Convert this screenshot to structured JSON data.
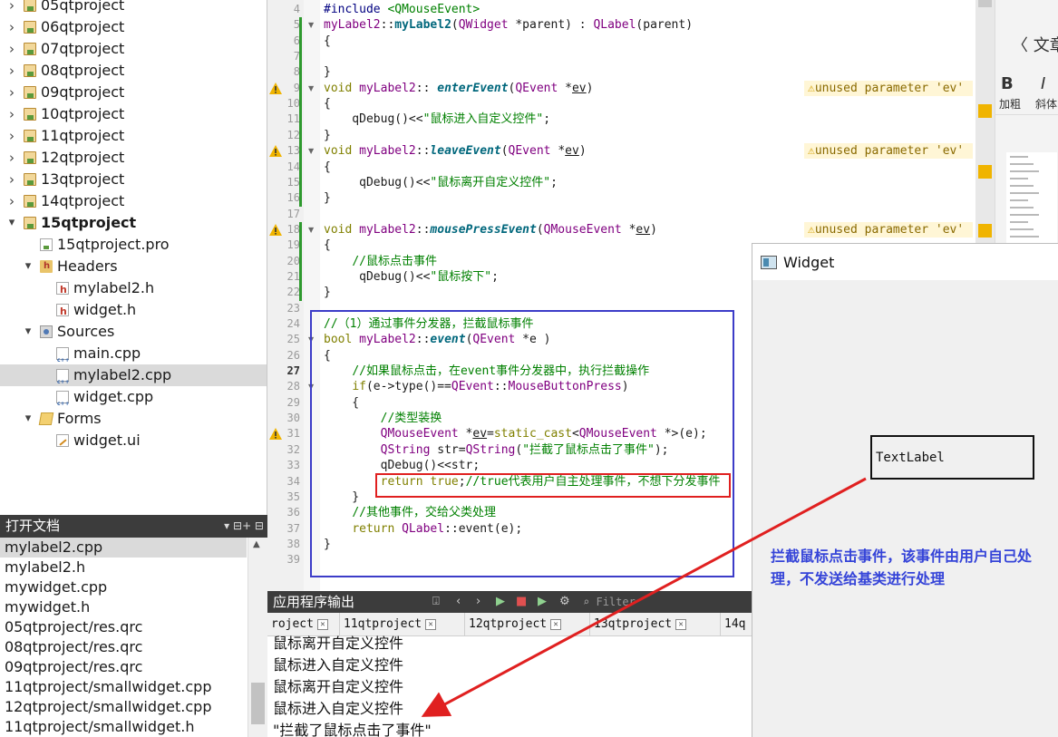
{
  "project_tree": [
    {
      "label": "05qtproject",
      "type": "project",
      "indent": 0,
      "arrow": "›"
    },
    {
      "label": "06qtproject",
      "type": "project",
      "indent": 0,
      "arrow": "›"
    },
    {
      "label": "07qtproject",
      "type": "project",
      "indent": 0,
      "arrow": "›"
    },
    {
      "label": "08qtproject",
      "type": "project",
      "indent": 0,
      "arrow": "›"
    },
    {
      "label": "09qtproject",
      "type": "project",
      "indent": 0,
      "arrow": "›"
    },
    {
      "label": "10qtproject",
      "type": "project",
      "indent": 0,
      "arrow": "›"
    },
    {
      "label": "11qtproject",
      "type": "project",
      "indent": 0,
      "arrow": "›"
    },
    {
      "label": "12qtproject",
      "type": "project",
      "indent": 0,
      "arrow": "›"
    },
    {
      "label": "13qtproject",
      "type": "project",
      "indent": 0,
      "arrow": "›"
    },
    {
      "label": "14qtproject",
      "type": "project",
      "indent": 0,
      "arrow": "›"
    },
    {
      "label": "15qtproject",
      "type": "project",
      "indent": 0,
      "arrow": "⌄",
      "bold": true
    },
    {
      "label": "15qtproject.pro",
      "type": "pro",
      "indent": 1,
      "arrow": ""
    },
    {
      "label": "Headers",
      "type": "folder-h",
      "indent": 1,
      "arrow": "⌄"
    },
    {
      "label": "mylabel2.h",
      "type": "h",
      "indent": 2,
      "arrow": ""
    },
    {
      "label": "widget.h",
      "type": "h",
      "indent": 2,
      "arrow": ""
    },
    {
      "label": "Sources",
      "type": "folder-s",
      "indent": 1,
      "arrow": "⌄"
    },
    {
      "label": "main.cpp",
      "type": "cpp",
      "indent": 2,
      "arrow": ""
    },
    {
      "label": "mylabel2.cpp",
      "type": "cpp",
      "indent": 2,
      "arrow": "",
      "selected": true
    },
    {
      "label": "widget.cpp",
      "type": "cpp",
      "indent": 2,
      "arrow": ""
    },
    {
      "label": "Forms",
      "type": "folder-f",
      "indent": 1,
      "arrow": "⌄"
    },
    {
      "label": "widget.ui",
      "type": "ui",
      "indent": 2,
      "arrow": ""
    }
  ],
  "open_docs": {
    "title": "打开文档",
    "tools": "▾ ⊟+ ⊟",
    "items": [
      {
        "label": "mylabel2.cpp",
        "selected": true
      },
      {
        "label": "mylabel2.h"
      },
      {
        "label": "mywidget.cpp"
      },
      {
        "label": "mywidget.h"
      },
      {
        "label": "05qtproject/res.qrc"
      },
      {
        "label": "08qtproject/res.qrc"
      },
      {
        "label": "09qtproject/res.qrc"
      },
      {
        "label": "11qtproject/smallwidget.cpp"
      },
      {
        "label": "12qtproject/smallwidget.cpp"
      },
      {
        "label": "11qtproject/smallwidget.h"
      }
    ]
  },
  "editor": {
    "current_line": 27,
    "warning_text": "unused parameter 'ev'",
    "lines": [
      {
        "n": 4,
        "html": "<span class='pp'>#include</span> <span class='incl'>&lt;QMouseEvent&gt;</span>"
      },
      {
        "n": 5,
        "html": "<span class='ty'>myLabel2</span>::<span class='fn-b'>myLabel2</span>(<span class='cls'>QWidget</span> *parent) : <span class='cls'>QLabel</span>(parent)"
      },
      {
        "n": 6,
        "html": "{"
      },
      {
        "n": 7,
        "html": ""
      },
      {
        "n": 8,
        "html": "}"
      },
      {
        "n": 9,
        "html": "<span class='kw'>void</span> <span class='ty'>myLabel2</span>:: <span class='fn-i'>enterEvent</span>(<span class='cls'>QEvent</span> *<span class='ul'>ev</span>)",
        "warn": true
      },
      {
        "n": 10,
        "html": "{"
      },
      {
        "n": 11,
        "html": "    qDebug()&lt;&lt;<span class='st'>\"鼠标进入自定义控件\"</span>;"
      },
      {
        "n": 12,
        "html": "}"
      },
      {
        "n": 13,
        "html": "<span class='kw'>void</span> <span class='ty'>myLabel2</span>::<span class='fn-i'>leaveEvent</span>(<span class='cls'>QEvent</span> *<span class='ul'>ev</span>)",
        "warn": true
      },
      {
        "n": 14,
        "html": "{"
      },
      {
        "n": 15,
        "html": "     qDebug()&lt;&lt;<span class='st'>\"鼠标离开自定义控件\"</span>;"
      },
      {
        "n": 16,
        "html": "}"
      },
      {
        "n": 17,
        "html": ""
      },
      {
        "n": 18,
        "html": "<span class='kw'>void</span> <span class='ty'>myLabel2</span>::<span class='fn-i'>mousePressEvent</span>(<span class='cls'>QMouseEvent</span> *<span class='ul'>ev</span>)",
        "warn": true
      },
      {
        "n": 19,
        "html": "{"
      },
      {
        "n": 20,
        "html": "    <span class='cm'>//鼠标点击事件</span>"
      },
      {
        "n": 21,
        "html": "     qDebug()&lt;&lt;<span class='st'>\"鼠标按下\"</span>;"
      },
      {
        "n": 22,
        "html": "}"
      },
      {
        "n": 23,
        "html": ""
      },
      {
        "n": 24,
        "html": "<span class='cm'>//（1）通过事件分发器，拦截鼠标事件</span>"
      },
      {
        "n": 25,
        "html": "<span class='kw'>bool</span> <span class='ty'>myLabel2</span>::<span class='fn-i'>event</span>(<span class='cls'>QEvent</span> *e )"
      },
      {
        "n": 26,
        "html": "{"
      },
      {
        "n": 27,
        "html": "    <span class='cm'>//如果鼠标点击，在event事件分发器中，执行拦截操作</span>"
      },
      {
        "n": 28,
        "html": "    <span class='kw'>if</span>(e-&gt;type()==<span class='cls'>QEvent</span>::<span class='ty'>MouseButtonPress</span>)"
      },
      {
        "n": 29,
        "html": "    {"
      },
      {
        "n": 30,
        "html": "        <span class='cm'>//类型装换</span>"
      },
      {
        "n": 31,
        "html": "        <span class='cls'>QMouseEvent</span> *<span class='ul'>ev</span>=<span class='kw'>static_cast</span>&lt;<span class='cls'>QMouseEvent</span> *&gt;(e);",
        "warn": true
      },
      {
        "n": 32,
        "html": "        <span class='cls'>QString</span> str=<span class='cls'>QString</span>(<span class='st'>\"拦截了鼠标点击了事件\"</span>);"
      },
      {
        "n": 33,
        "html": "        qDebug()&lt;&lt;str;"
      },
      {
        "n": 34,
        "html": "        <span class='kw'>return</span> <span class='kw'>true</span>;<span class='cm'>//true代表用户自主处理事件，不想下分发事件</span>"
      },
      {
        "n": 35,
        "html": "    }"
      },
      {
        "n": 36,
        "html": "    <span class='cm'>//其他事件，交给父类处理</span>"
      },
      {
        "n": 37,
        "html": "    <span class='kw'>return</span> <span class='cls'>QLabel</span>::event(e);"
      },
      {
        "n": 38,
        "html": "}"
      },
      {
        "n": 39,
        "html": ""
      }
    ]
  },
  "output": {
    "title": "应用程序输出",
    "filter_placeholder": "Filter",
    "tabs": [
      {
        "label": "roject"
      },
      {
        "label": "11qtproject"
      },
      {
        "label": "12qtproject"
      },
      {
        "label": "13qtproject"
      },
      {
        "label": "14q"
      }
    ],
    "lines": [
      "鼠标离开自定义控件",
      "鼠标进入自定义控件",
      "鼠标离开自定义控件",
      "鼠标进入自定义控件",
      "\"拦截了鼠标点击了事件\""
    ]
  },
  "right_window": {
    "back_text": "文章",
    "bold_glyph": "B",
    "bold_label": "加粗",
    "italic_glyph": "I",
    "italic_label": "斜体"
  },
  "widget_window": {
    "title": "Widget",
    "text_label": "TextLabel",
    "annotation": "拦截鼠标点击事件，该事件由用户自己处理，不发送给基类进行处理"
  },
  "colors": {
    "highlight_blue": "#3c3cc8",
    "highlight_red": "#e02020",
    "annotation_blue": "#3544d8",
    "warning_yellow": "#f0b400"
  }
}
